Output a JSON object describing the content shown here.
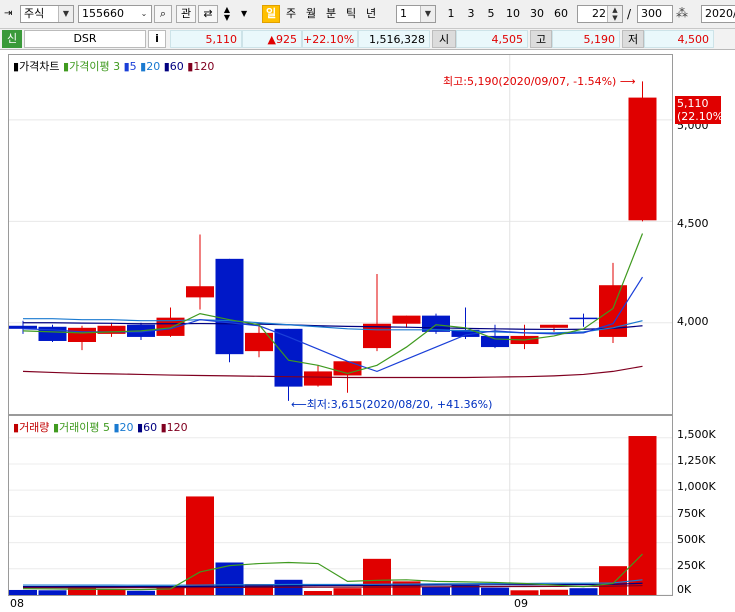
{
  "toolbar": {
    "market_type": "주식",
    "stock_code": "155660",
    "search_btn": "⌕",
    "watch_btn": "관",
    "periods": [
      {
        "label": "일",
        "active": true
      },
      {
        "label": "주",
        "active": false
      },
      {
        "label": "월",
        "active": false
      },
      {
        "label": "분",
        "active": false
      },
      {
        "label": "틱",
        "active": false
      },
      {
        "label": "년",
        "active": false
      }
    ],
    "interval_value": "1",
    "quick_intervals": [
      "1",
      "3",
      "5",
      "10",
      "30",
      "60"
    ],
    "count_value": "22",
    "total_value": "300",
    "date_value": "2020/"
  },
  "quote": {
    "badge": "신",
    "name": "DSR",
    "info_btn": "i",
    "price": "5,110",
    "change": "▲925",
    "change_pct": "+22.10%",
    "volume": "1,516,328",
    "open_label": "시",
    "open": "4,505",
    "high_label": "고",
    "high": "5,190",
    "low_label": "저",
    "low": "4,500"
  },
  "price_pane": {
    "legend": {
      "title": "가격차트",
      "ma_title": "가격이평",
      "ma_periods": [
        "3",
        "5",
        "20",
        "60",
        "120"
      ]
    },
    "high_annotation": "최고:5,190(2020/09/07, -1.54%)",
    "low_annotation": "최저:3,615(2020/08/20, +41.36%)",
    "current_price_label": "5,110",
    "current_pct_label": "(22.10%)",
    "y_ticks": [
      "5,000",
      "4,500",
      "4,000"
    ]
  },
  "volume_pane": {
    "legend": {
      "title": "거래량",
      "ma_title": "거래이평",
      "ma_periods": [
        "5",
        "20",
        "60",
        "120"
      ]
    },
    "y_ticks": [
      "1,500K",
      "1,250K",
      "1,000K",
      "750K",
      "500K",
      "250K",
      "0K"
    ]
  },
  "x_ticks": [
    "08",
    "09"
  ],
  "colors": {
    "up": "#e00000",
    "down": "#0018c8",
    "ma3": "#3f9a1f",
    "ma5": "#1a3fd8",
    "ma20": "#1a7ad0",
    "ma60": "#000080",
    "ma120": "#800020",
    "vol_ma5": "#3f9a1f"
  },
  "chart_data": {
    "type": "candlestick",
    "dates": [
      "2020/08/06",
      "2020/08/07",
      "2020/08/10",
      "2020/08/11",
      "2020/08/12",
      "2020/08/13",
      "2020/08/14",
      "2020/08/18",
      "2020/08/19",
      "2020/08/20",
      "2020/08/21",
      "2020/08/24",
      "2020/08/25",
      "2020/08/26",
      "2020/08/27",
      "2020/08/28",
      "2020/08/31",
      "2020/09/01",
      "2020/09/02",
      "2020/09/03",
      "2020/09/04",
      "2020/09/07"
    ],
    "ohlc": [
      [
        3985,
        4010,
        3945,
        3970
      ],
      [
        3980,
        3990,
        3905,
        3910
      ],
      [
        3905,
        3985,
        3865,
        3975
      ],
      [
        3945,
        4000,
        3930,
        3985
      ],
      [
        3990,
        4000,
        3915,
        3930
      ],
      [
        3935,
        4075,
        3930,
        4025
      ],
      [
        4125,
        4435,
        4065,
        4180
      ],
      [
        4315,
        4315,
        3805,
        3845
      ],
      [
        3860,
        3995,
        3830,
        3950
      ],
      [
        3970,
        3970,
        3615,
        3685
      ],
      [
        3690,
        3790,
        3685,
        3760
      ],
      [
        3740,
        3790,
        3655,
        3810
      ],
      [
        3875,
        4240,
        3860,
        3995
      ],
      [
        3995,
        4035,
        3975,
        4035
      ],
      [
        4035,
        4045,
        3945,
        3955
      ],
      [
        3965,
        4075,
        3920,
        3930
      ],
      [
        3935,
        3990,
        3875,
        3880
      ],
      [
        3895,
        3990,
        3870,
        3935
      ],
      [
        3975,
        3990,
        3955,
        3990
      ],
      [
        4025,
        4045,
        3980,
        4020
      ],
      [
        3930,
        4295,
        3900,
        4185
      ],
      [
        4505,
        5190,
        4500,
        5110
      ]
    ],
    "ma3": [
      3960,
      3955,
      3950,
      3955,
      3960,
      3975,
      4045,
      4015,
      3990,
      3815,
      3790,
      3750,
      3790,
      3880,
      3990,
      3975,
      3920,
      3915,
      3935,
      3970,
      4070,
      4440
    ],
    "ma5": [
      3970,
      3965,
      3955,
      3955,
      3955,
      3970,
      4015,
      4000,
      3985,
      3930,
      3870,
      3810,
      3760,
      3820,
      3880,
      3940,
      3960,
      3950,
      3945,
      3950,
      3995,
      4225
    ],
    "ma20": [
      4020,
      4020,
      4015,
      4015,
      4010,
      4010,
      4015,
      4010,
      4000,
      3990,
      3980,
      3970,
      3965,
      3965,
      3965,
      3960,
      3955,
      3950,
      3950,
      3955,
      3975,
      4010
    ],
    "ma60": [
      4000,
      4000,
      3998,
      3997,
      3995,
      3995,
      3996,
      3995,
      3993,
      3990,
      3985,
      3982,
      3980,
      3978,
      3975,
      3972,
      3970,
      3968,
      3967,
      3968,
      3972,
      3985
    ],
    "ma120": [
      3760,
      3755,
      3750,
      3748,
      3745,
      3742,
      3740,
      3738,
      3736,
      3734,
      3732,
      3730,
      3730,
      3730,
      3730,
      3730,
      3732,
      3734,
      3738,
      3745,
      3760,
      3785
    ],
    "volume": [
      48000,
      45000,
      70000,
      52000,
      40000,
      85000,
      940000,
      310000,
      105000,
      145000,
      38000,
      65000,
      345000,
      130000,
      80000,
      92000,
      70000,
      45000,
      50000,
      65000,
      275000,
      1516328
    ],
    "volume_ma5": [
      60000,
      58000,
      55000,
      54000,
      51000,
      58000,
      220000,
      280000,
      300000,
      310000,
      300000,
      130000,
      140000,
      145000,
      130000,
      125000,
      120000,
      110000,
      95000,
      80000,
      110000,
      390000
    ],
    "volume_ma20": [
      95000,
      95000,
      94000,
      94000,
      93000,
      93000,
      95000,
      98000,
      98000,
      100000,
      100000,
      100000,
      102000,
      104000,
      106000,
      108000,
      110000,
      110000,
      112000,
      112000,
      115000,
      145000
    ],
    "volume_ma60": [
      80000,
      80000,
      80000,
      80000,
      80000,
      80000,
      82000,
      84000,
      86000,
      88000,
      90000,
      90000,
      92000,
      94000,
      95000,
      96000,
      97000,
      98000,
      99000,
      100000,
      102000,
      112000
    ],
    "volume_ma120": [
      70000,
      70000,
      70000,
      70000,
      70000,
      70000,
      71000,
      72000,
      73000,
      74000,
      75000,
      75000,
      76000,
      77000,
      78000,
      79000,
      80000,
      81000,
      82000,
      83000,
      84000,
      90000
    ],
    "price_ylim": [
      3550,
      5320
    ],
    "volume_ylim": [
      0,
      1650000
    ],
    "y_ticks": [
      4000,
      4500,
      5000
    ],
    "volume_y_ticks": [
      0,
      250000,
      500000,
      750000,
      1000000,
      1250000,
      1500000
    ],
    "x_tick_labels": [
      "08",
      "09"
    ],
    "grid": true
  }
}
